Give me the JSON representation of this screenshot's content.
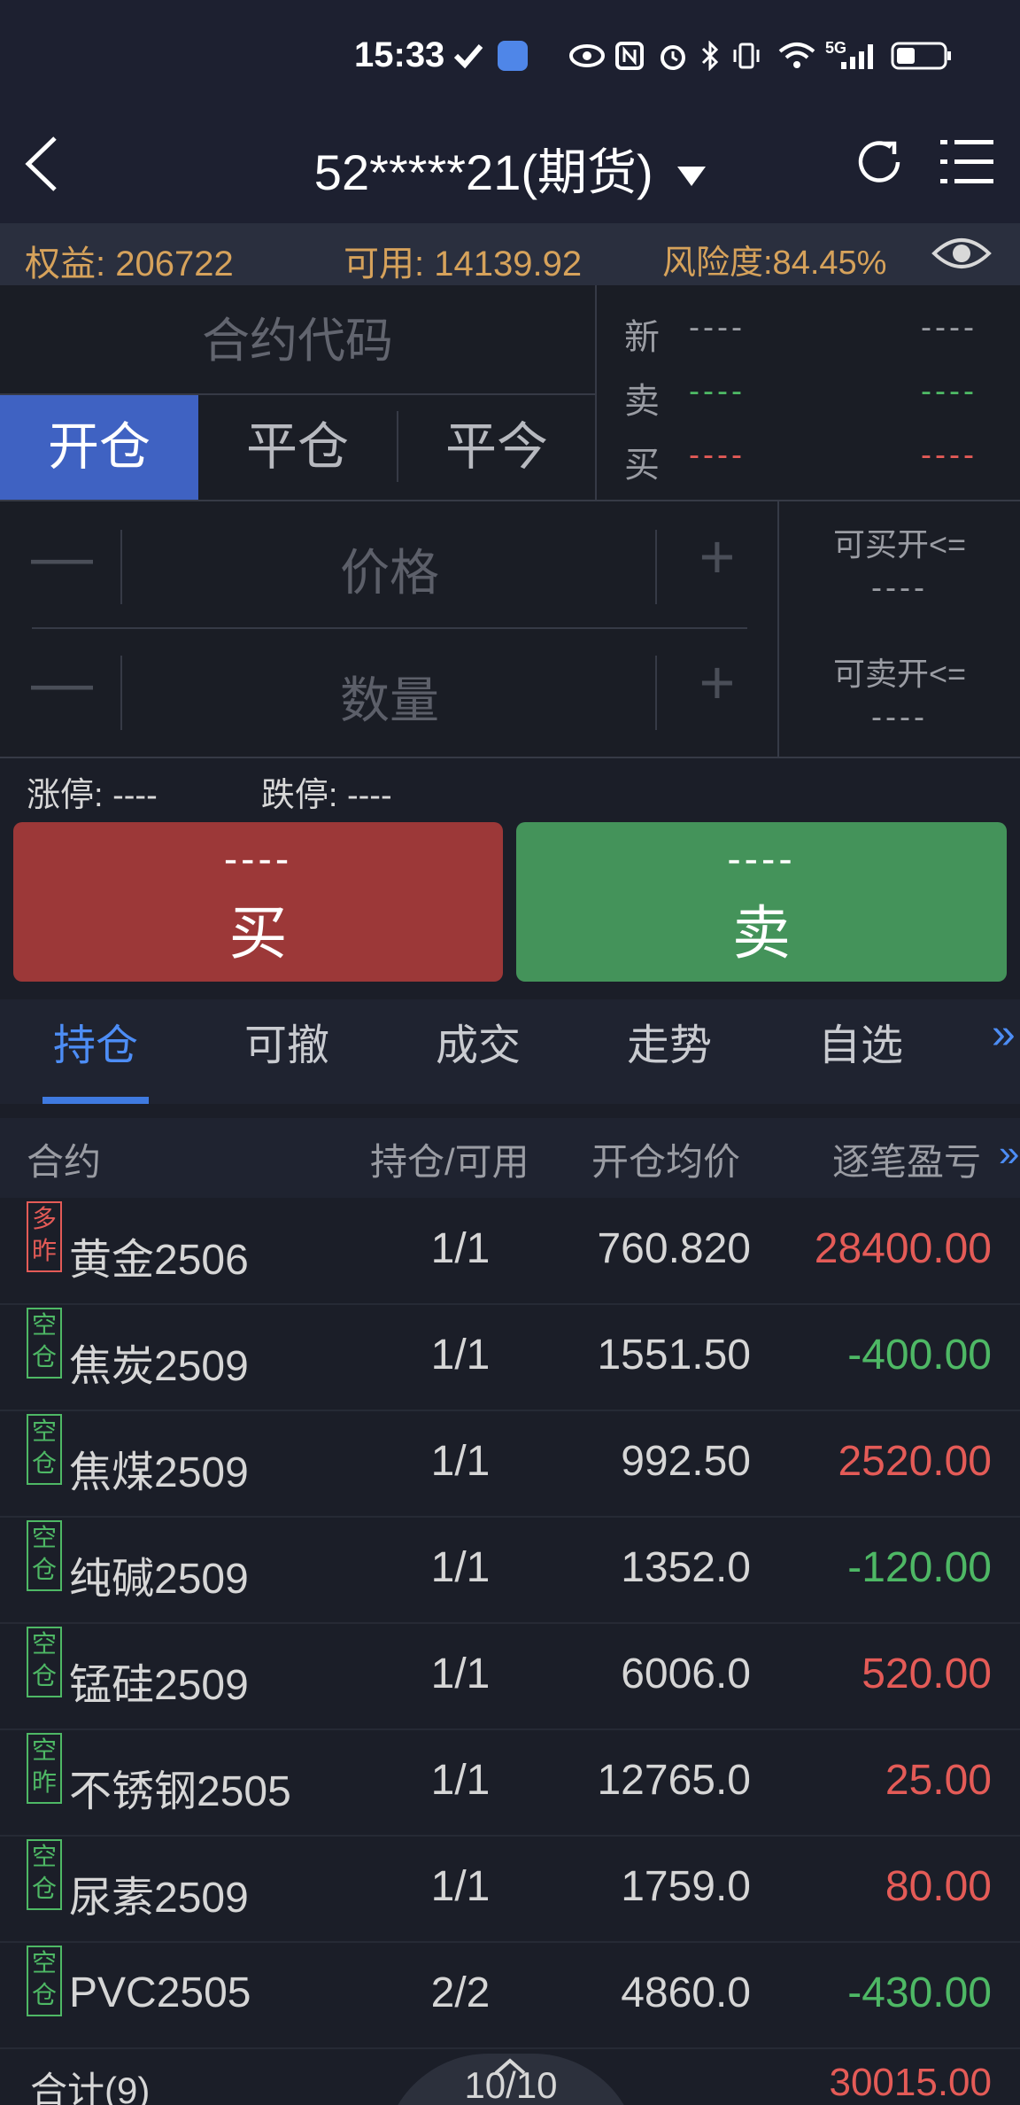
{
  "status": {
    "time": "15:33",
    "network": "5G"
  },
  "header": {
    "account": "52*****21(期货)"
  },
  "account_info": {
    "equity": "权益: 206722",
    "available": "可用: 14139.92",
    "risk": "风险度:84.45%"
  },
  "order": {
    "contract_placeholder": "合约代码",
    "tabs": [
      "开仓",
      "平仓",
      "平今"
    ],
    "quotes": [
      {
        "label": "新",
        "left": "----",
        "right": "----"
      },
      {
        "label": "卖",
        "left": "----",
        "right": "----"
      },
      {
        "label": "买",
        "left": "----",
        "right": "----"
      }
    ],
    "price_placeholder": "价格",
    "qty_placeholder": "数量",
    "minus": "—",
    "plus": "+",
    "max_buy_label": "可买开<=",
    "max_buy_value": "----",
    "max_sell_label": "可卖开<=",
    "max_sell_value": "----",
    "limit_up": "涨停: ----",
    "limit_down": "跌停: ----",
    "buy_price": "----",
    "buy_label": "买",
    "sell_price": "----",
    "sell_label": "卖"
  },
  "bottom_tabs": [
    "持仓",
    "可撤",
    "成交",
    "走势",
    "自选",
    "»"
  ],
  "table": {
    "headers": [
      "合约",
      "持仓/可用",
      "开仓均价",
      "逐笔盈亏"
    ],
    "more": "»",
    "rows": [
      {
        "badge": "多昨",
        "name": "黄金2506",
        "qty": "1/1",
        "price": "760.820",
        "pnl": "28400.00"
      },
      {
        "badge": "空仓",
        "name": "焦炭2509",
        "qty": "1/1",
        "price": "1551.50",
        "pnl": "-400.00"
      },
      {
        "badge": "空仓",
        "name": "焦煤2509",
        "qty": "1/1",
        "price": "992.50",
        "pnl": "2520.00"
      },
      {
        "badge": "空仓",
        "name": "纯碱2509",
        "qty": "1/1",
        "price": "1352.0",
        "pnl": "-120.00"
      },
      {
        "badge": "空仓",
        "name": "锰硅2509",
        "qty": "1/1",
        "price": "6006.0",
        "pnl": "520.00"
      },
      {
        "badge": "空昨",
        "name": "不锈钢2505",
        "qty": "1/1",
        "price": "12765.0",
        "pnl": "25.00"
      },
      {
        "badge": "空仓",
        "name": "尿素2509",
        "qty": "1/1",
        "price": "1759.0",
        "pnl": "80.00"
      },
      {
        "badge": "空仓",
        "name": "PVC2505",
        "qty": "2/2",
        "price": "4860.0",
        "pnl": "-430.00"
      }
    ],
    "total_label": "合计(9)",
    "total_qty": "10/10",
    "total_pnl": "30015.00"
  },
  "colors": {
    "up": "#e45b57",
    "down": "#4eb865",
    "accent": "#3f62c2",
    "warning": "#d6a25b"
  }
}
